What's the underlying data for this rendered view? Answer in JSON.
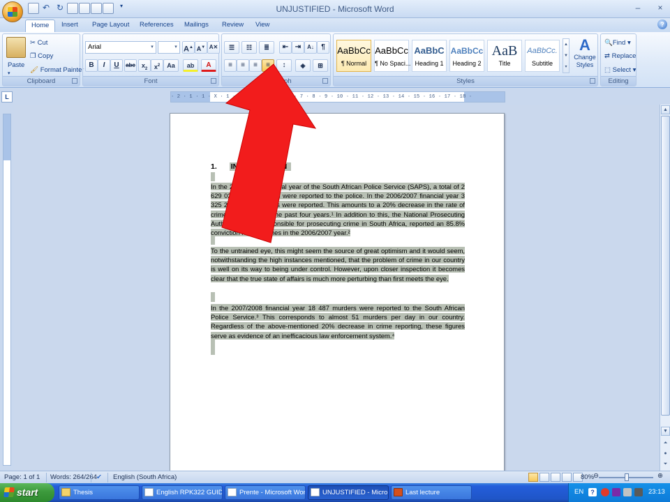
{
  "title_bar": {
    "title": "UNJUSTIFIED - Microsoft Word",
    "minimize": "–",
    "close": "×"
  },
  "tabs": [
    "Home",
    "Insert",
    "Page Layout",
    "References",
    "Mailings",
    "Review",
    "View"
  ],
  "ribbon": {
    "clipboard": {
      "label": "Clipboard",
      "paste": "Paste",
      "cut": "Cut",
      "copy": "Copy",
      "format_painter": "Format Painter"
    },
    "font": {
      "label": "Font",
      "font_name": "Arial",
      "font_size": ""
    },
    "paragraph": {
      "label": "Paragraph"
    },
    "styles": {
      "label": "Styles",
      "change_styles": "Change Styles",
      "tiles": [
        {
          "preview": "AaBbCc",
          "name": "¶ Normal"
        },
        {
          "preview": "AaBbCc",
          "name": "¶ No Spaci..."
        },
        {
          "preview": "AaBbC",
          "name": "Heading 1"
        },
        {
          "preview": "AaBbCc",
          "name": "Heading 2"
        },
        {
          "preview": "AaB",
          "name": "Title"
        },
        {
          "preview": "AaBbCc.",
          "name": "Subtitle"
        }
      ]
    },
    "editing": {
      "label": "Editing",
      "find": "Find",
      "replace": "Replace",
      "select": "Select"
    }
  },
  "ruler_numbers": "· 2 · 1 · 1 · X · 1 · 2 · 3 · 4 · 5 · 6 · 7 · 8 · 9 · 10 · 11 · 12 · 13 · 14 · 15 · 16 · 17 · 18 ·",
  "document": {
    "heading_number": "1.",
    "heading_text": "INTRODUCTION",
    "paragraphs": [
      "In the 2007/2008 financial year of the South African Police Service (SAPS), a total of 2 629 023 serious crimes were reported to the police. In the 2006/2007 financial year 3 325 226 serious crimes were reported. This amounts to a 20% decrease in the rate of crime reporting over the past four years.¹ In addition to this, the National Prosecuting Authority (NPA), responsible for prosecuting crime in South Africa, reported an 85.8% conviction rate of crimes in the 2006/2007 year.²",
      "To the untrained eye, this might seem the source of great optimism and it would seem, notwithstanding the high instances mentioned, that the problem of crime in our country is well on its way to being under control. However, upon closer inspection it becomes clear that the true state of affairs is much more perturbing than first meets the eye.",
      "In the 2007/2008 financial year 18 487 murders were reported to the South African Police Service.³ This corresponds to almost 51 murders per day in our country. Regardless of the above-mentioned 20% decrease in crime reporting, these figures serve as evidence of an inefficacious law enforcement system.⁴"
    ]
  },
  "status_bar": {
    "page": "Page: 1 of 1",
    "words": "Words: 264/264",
    "language": "English (South Africa)",
    "zoom": "80%"
  },
  "taskbar": {
    "start": "start",
    "items": [
      "Thesis",
      "English RPK322 GUID...",
      "Prente - Microsoft Word",
      "UNJUSTIFIED - Micro...",
      "Last lecture"
    ],
    "active_index": 3,
    "lang": "EN",
    "clock": "23:13"
  },
  "colors": {
    "selection": "#b8c0b4",
    "arrow": "#f21c1c"
  }
}
